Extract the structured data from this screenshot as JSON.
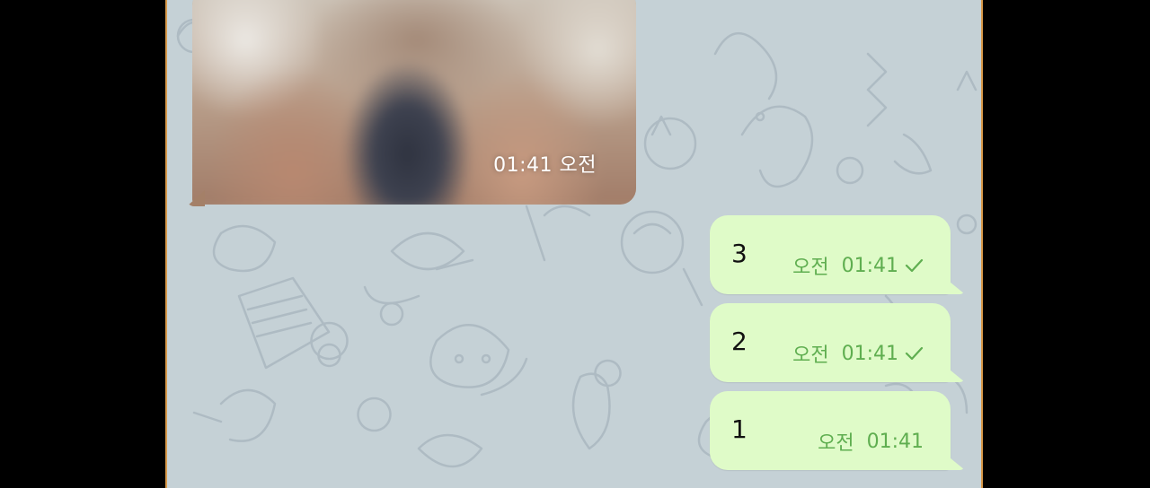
{
  "incoming_image": {
    "time": "01:41",
    "ampm": "오전"
  },
  "messages": [
    {
      "text": "3",
      "ampm": "오전",
      "time": "01:41",
      "check": "single-check-icon"
    },
    {
      "text": "2",
      "ampm": "오전",
      "time": "01:41",
      "check": "single-check-icon"
    },
    {
      "text": "1",
      "ampm": "오전",
      "time": "01:41"
    }
  ],
  "colors": {
    "outgoing_bubble": "#dffbc8",
    "meta_text": "#5fae50",
    "chat_background": "#c5d1d6",
    "frame_border": "#d99a4a"
  }
}
